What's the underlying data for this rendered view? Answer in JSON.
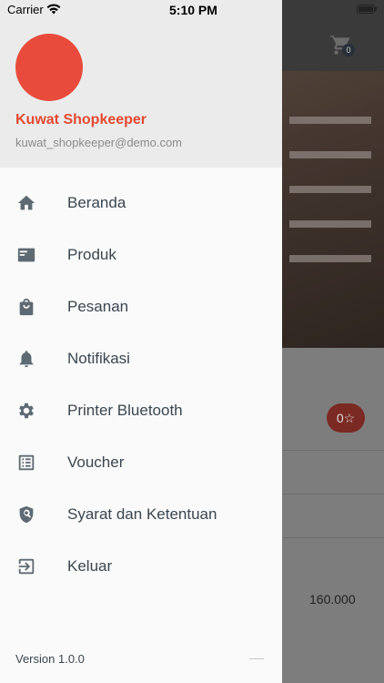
{
  "status_bar": {
    "carrier": "Carrier",
    "time": "5:10 PM"
  },
  "background": {
    "cart_count": "0",
    "rating": "0☆",
    "price": "160.000"
  },
  "drawer": {
    "user": {
      "name": "Kuwat Shopkeeper",
      "email": "kuwat_shopkeeper@demo.com"
    },
    "menu": [
      {
        "label": "Beranda",
        "icon": "home-icon"
      },
      {
        "label": "Produk",
        "icon": "product-card-icon"
      },
      {
        "label": "Pesanan",
        "icon": "shopping-bag-icon"
      },
      {
        "label": "Notifikasi",
        "icon": "bell-icon"
      },
      {
        "label": "Printer Bluetooth",
        "icon": "gear-icon"
      },
      {
        "label": "Voucher",
        "icon": "list-icon"
      },
      {
        "label": "Syarat dan Ketentuan",
        "icon": "shield-search-icon"
      },
      {
        "label": "Keluar",
        "icon": "logout-icon"
      }
    ],
    "version": "Version 1.0.0"
  },
  "colors": {
    "accent": "#e34a33",
    "avatar": "#e84b3c",
    "icon": "#5d6a73",
    "text": "#3a4650"
  }
}
